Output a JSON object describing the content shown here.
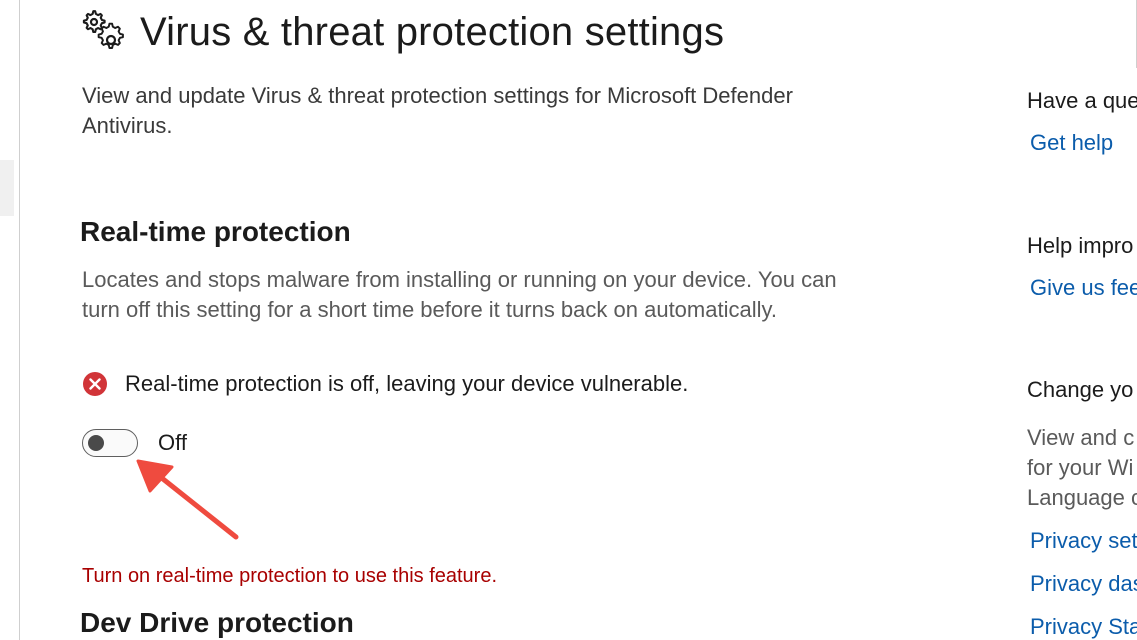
{
  "header": {
    "title": "Virus & threat protection settings",
    "subtitle": "View and update Virus & threat protection settings for Microsoft Defender Antivirus."
  },
  "realtime": {
    "title": "Real-time protection",
    "description": "Locates and stops malware from installing or running on your device. You can turn off this setting for a short time before it turns back on automatically.",
    "warning": "Real-time protection is off, leaving your device vulnerable.",
    "toggle_state": "Off",
    "feature_message": "Turn on real-time protection to use this feature."
  },
  "devdrive": {
    "title": "Dev Drive protection"
  },
  "sidebar": {
    "question_heading": "Have a que",
    "get_help": "Get help",
    "improve_heading": "Help impro",
    "feedback_link": "Give us feed",
    "change_heading": "Change yo",
    "privacy_text_1": "View and c",
    "privacy_text_2": "for your Wi",
    "privacy_text_3": "Language c",
    "privacy_settings_link": "Privacy sett",
    "privacy_dashboard_link": "Privacy dash",
    "privacy_statement_link": "Privacy Stat"
  },
  "icons": {
    "header": "gears-icon",
    "warning": "error-x-icon",
    "annotation": "red-arrow-icon"
  },
  "colors": {
    "link": "#0b5cab",
    "error": "#d13438",
    "error_text": "#a80000",
    "annotation_arrow": "#ef4b3f"
  }
}
